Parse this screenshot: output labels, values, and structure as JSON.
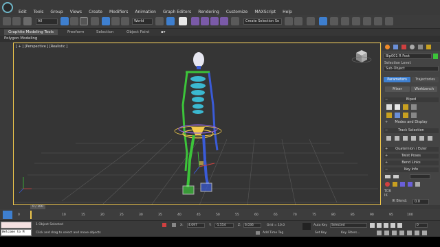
{
  "menu": {
    "items": [
      "Edit",
      "Tools",
      "Group",
      "Views",
      "Create",
      "Modifiers",
      "Animation",
      "Graph Editors",
      "Rendering",
      "Customize",
      "MAXScript",
      "Help"
    ]
  },
  "toolbar": {
    "selection_filter": "All",
    "reference_coord": "World",
    "named_selection": "Create Selection Se"
  },
  "ribbon": {
    "tabs": [
      "Graphite Modeling Tools",
      "Freeform",
      "Selection",
      "Object Paint"
    ],
    "sub_label": "Polygon Modeling"
  },
  "viewport": {
    "label": "[ + ] [Perspective ] [Realistic ]"
  },
  "command_panel": {
    "object_name": "Bip001 R Foot",
    "selection_level_label": "Selection Level:",
    "sub_object_value": "Sub-Object",
    "tabs": [
      "Parameters",
      "Trajectories"
    ],
    "mixer_button": "Mixer",
    "workbench_button": "Workbench",
    "rollouts": {
      "biped": "Biped",
      "modes_display": "Modes and Display",
      "track_selection": "Track Selection",
      "quaternion_euler": "Quaternion / Euler",
      "twist_poses": "Twist Poses",
      "bend_links": "Bend Links",
      "key_info": "Key Info"
    },
    "tcb_label": "TCB",
    "ik_label": "IK",
    "ik_blend_label": "IK Blend:",
    "ik_blend_value": "0.0",
    "ankle_tension_label": "Ankle Tension:",
    "ankle_tension_value": "0.0"
  },
  "timeline": {
    "frame_counter": "0 / 100",
    "ticks": [
      "0",
      "10",
      "15",
      "20",
      "25",
      "30",
      "35",
      "40",
      "45",
      "50",
      "55",
      "60",
      "65",
      "70",
      "75",
      "80",
      "85",
      "90",
      "95",
      "100"
    ]
  },
  "status": {
    "maxscript_text": "Welcome to M",
    "selected_count": "1 Object Selected",
    "prompt": "Click and drag to select and move objects",
    "x_label": "X:",
    "x_value": "4.097",
    "y_label": "Y:",
    "y_value": "-1.554",
    "z_label": "Z:",
    "z_value": "6.036",
    "grid": "Grid = 10.0",
    "add_time_tag": "Add Time Tag",
    "auto_key": "Auto Key",
    "set_key": "Set Key",
    "key_mode": "Selected",
    "key_filters": "Key Filters...",
    "frame_value": "0"
  },
  "colors": {
    "viewport_border": "#f2c94c",
    "active_tab": "#3e7fcf",
    "right_leg": "#3a5bd8",
    "left_leg": "#3cc43a",
    "spine": "#3bb8d0",
    "pelvis": "#f2c94c"
  }
}
